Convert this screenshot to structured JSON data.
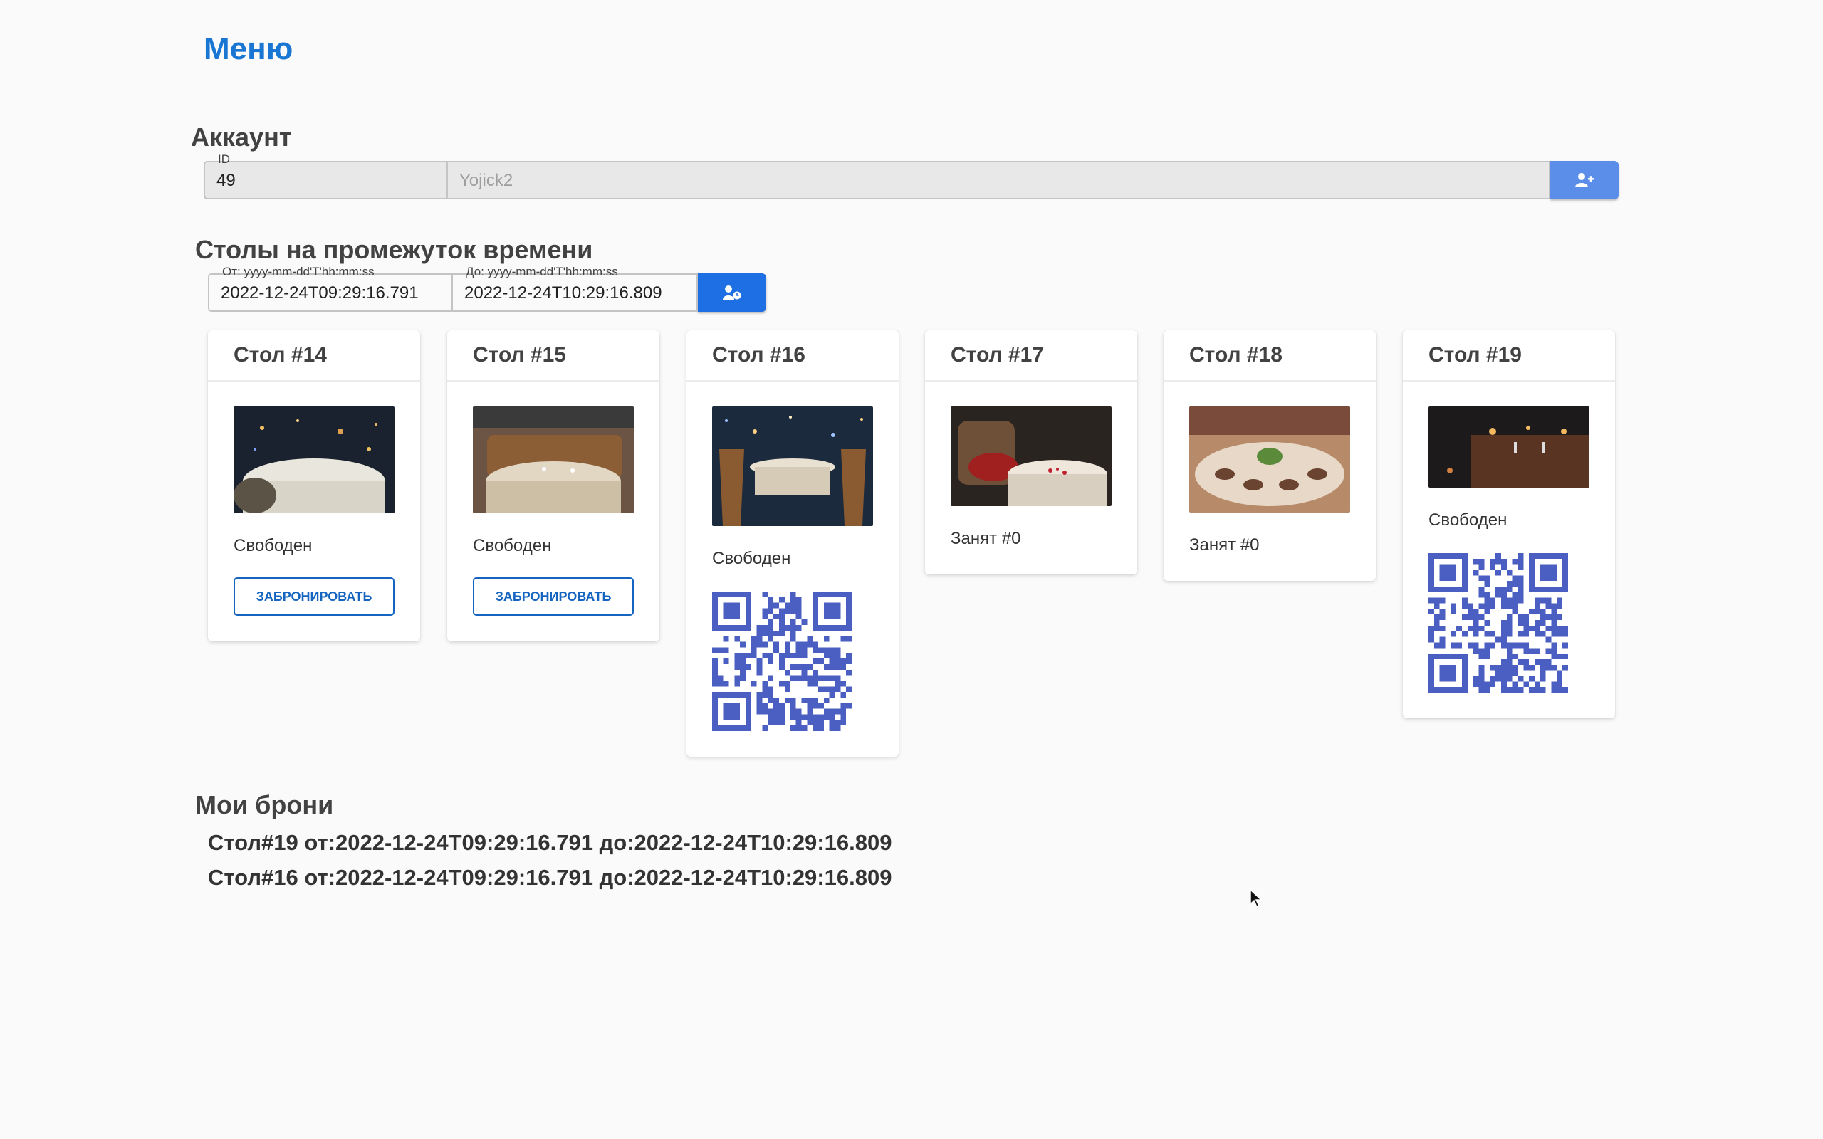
{
  "nav": {
    "menu_label": "Меню"
  },
  "account": {
    "title": "Аккаунт",
    "id_legend": "ID",
    "id_value": "49",
    "username": "Yojick2",
    "register_icon": "user-plus-icon"
  },
  "period": {
    "title": "Столы на промежуток времени",
    "from_legend": "От: yyyy-mm-dd'T'hh:mm:ss",
    "from_value": "2022-12-24T09:29:16.791",
    "to_legend": "До: yyyy-mm-dd'T'hh:mm:ss",
    "to_value": "2022-12-24T10:29:16.809",
    "search_icon": "user-clock-icon"
  },
  "tables": [
    {
      "title": "Стол #14",
      "status": "Свободен",
      "button": "ЗАБРОНИРОВАТЬ",
      "photo": "restaurant-table-photo"
    },
    {
      "title": "Стол #15",
      "status": "Свободен",
      "button": "ЗАБРОНИРОВАТЬ",
      "photo": "restaurant-table-photo"
    },
    {
      "title": "Стол #16",
      "status": "Свободен",
      "qr": "booking-qr-code",
      "photo": "restaurant-table-photo"
    },
    {
      "title": "Стол #17",
      "status": "Занят #0",
      "photo": "restaurant-table-photo"
    },
    {
      "title": "Стол #18",
      "status": "Занят #0",
      "photo": "restaurant-table-photo"
    },
    {
      "title": "Стол #19",
      "status": "Свободен",
      "qr": "booking-qr-code",
      "photo": "restaurant-table-photo"
    }
  ],
  "bookings": {
    "title": "Мои брони",
    "items": [
      "Стол#19 от:2022-12-24T09:29:16.791 до:2022-12-24T10:29:16.809",
      "Стол#16 от:2022-12-24T09:29:16.791 до:2022-12-24T10:29:16.809"
    ]
  },
  "colors": {
    "accent": "#1976d2",
    "button": "#1e6ee4",
    "qr": "#4a5fc1"
  }
}
